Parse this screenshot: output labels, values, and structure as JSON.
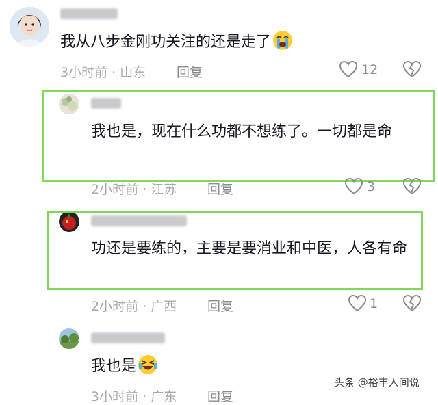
{
  "comments": [
    {
      "text": "我从八步金刚功关注的还是走了",
      "emoji": "loudly-crying-face",
      "time": "3小时前",
      "location": "山东",
      "reply_label": "回复",
      "likes": "12"
    },
    {
      "text": "我也是，现在什么功都不想练了。一切都是命",
      "time": "2小时前",
      "location": "江苏",
      "reply_label": "回复",
      "likes": "3"
    },
    {
      "text": "功还是要练的，主要是要消业和中医，人各有命",
      "time": "2小时前",
      "location": "广西",
      "reply_label": "回复",
      "likes": "1"
    },
    {
      "text": "我也是",
      "emoji": "rolling-laughing-face",
      "time": "3小时前",
      "location": "广东",
      "reply_label": "回复"
    }
  ],
  "separator": " · ",
  "watermark": "头条 @裕丰人间说",
  "colors": {
    "highlight": "#7ed957",
    "meta": "#a8a9ae"
  }
}
